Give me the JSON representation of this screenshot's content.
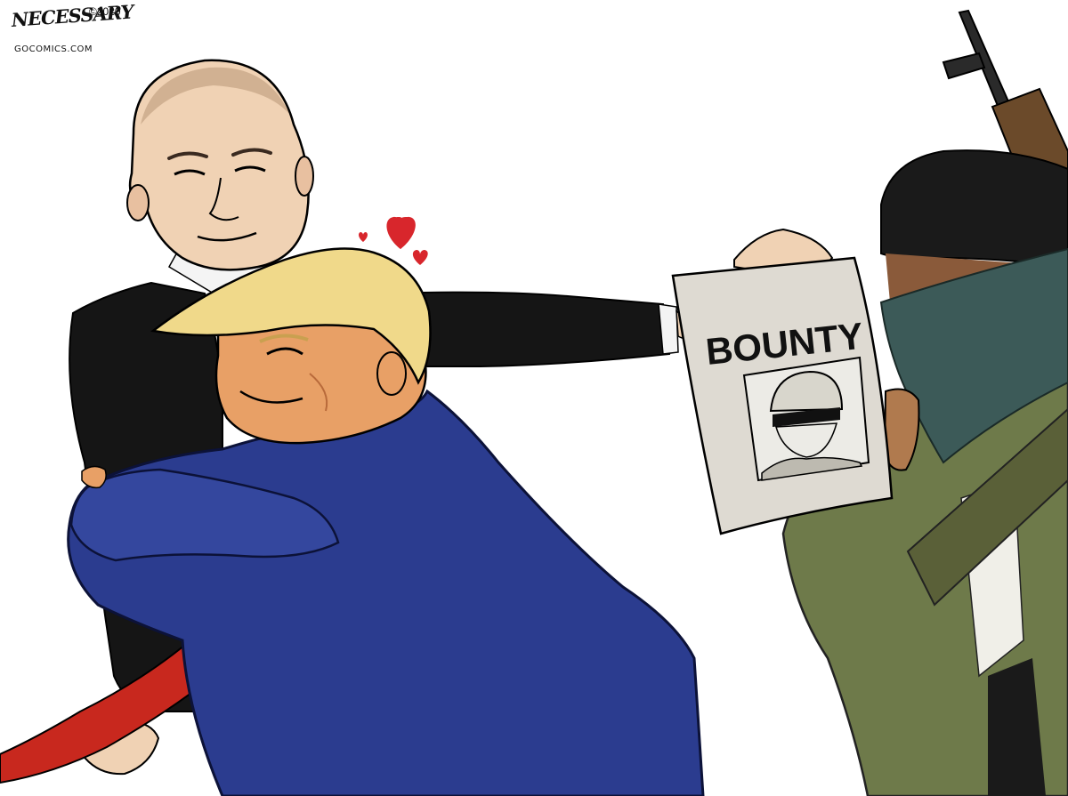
{
  "cartoon": {
    "signature": "NECESSARY",
    "copyright": "©2020",
    "website": "GOCOMICS.COM",
    "poster_text": "BOUNTY"
  },
  "colors": {
    "suit_blue": "#2b3c8f",
    "suit_black": "#151515",
    "tie_red": "#c8281e",
    "hair_blond": "#f0d98a",
    "skin_orange": "#e8a066",
    "skin_pale": "#f0d2b4",
    "paper": "#dedad2",
    "jacket_olive": "#6e7a4a",
    "scarf_teal": "#3c5a58",
    "heart_red": "#d8262c"
  }
}
